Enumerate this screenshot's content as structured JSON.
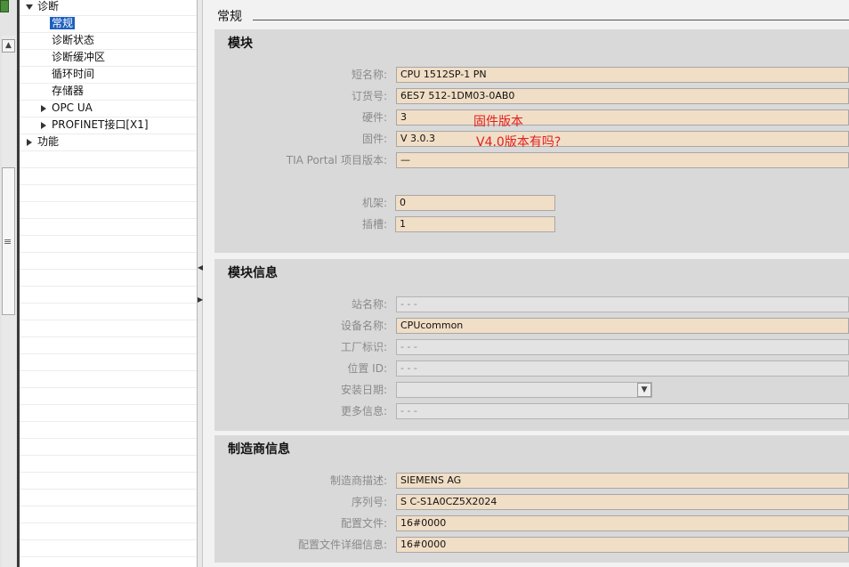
{
  "tree": {
    "root_label": "诊断",
    "children": [
      "常规",
      "诊断状态",
      "诊断缓冲区",
      "循环时间",
      "存储器"
    ],
    "opc_ua": "OPC UA",
    "profinet": "PROFINET接口[X1]",
    "functions": "功能"
  },
  "main": {
    "title": "常规"
  },
  "module": {
    "heading": "模块",
    "short_name_label": "短名称:",
    "short_name": "CPU 1512SP-1 PN",
    "order_label": "订货号:",
    "order_no": "6ES7 512-1DM03-0AB0",
    "hardware_label": "硬件:",
    "hardware": "3",
    "firmware_label": "固件:",
    "firmware": "V 3.0.3",
    "tia_label": "TIA Portal 项目版本:",
    "tia_version": "—",
    "rack_label": "机架:",
    "rack": "0",
    "slot_label": "插槽:",
    "slot": "1"
  },
  "annotations": {
    "firmware_version": "固件版本",
    "question": "V4.0版本有吗?"
  },
  "module_info": {
    "heading": "模块信息",
    "station_label": "站名称:",
    "station": "- - -",
    "device_label": "设备名称:",
    "device": "CPUcommon",
    "plant_label": "工厂标识:",
    "plant": "- - -",
    "location_label": "位置 ID:",
    "location": "- - -",
    "install_label": "安装日期:",
    "install": "",
    "more_label": "更多信息:",
    "more": "- - -"
  },
  "manufacturer": {
    "heading": "制造商信息",
    "desc_label": "制造商描述:",
    "desc": "SIEMENS AG",
    "serial_label": "序列号:",
    "serial": "S C-S1A0CZ5X2024",
    "profile_label": "配置文件:",
    "profile": "16#0000",
    "profile_detail_label": "配置文件详细信息:",
    "profile_detail": "16#0000"
  },
  "colors": {
    "field_bg": "#f1dec6",
    "selection": "#1d5fbf",
    "annotation": "#e02020"
  }
}
